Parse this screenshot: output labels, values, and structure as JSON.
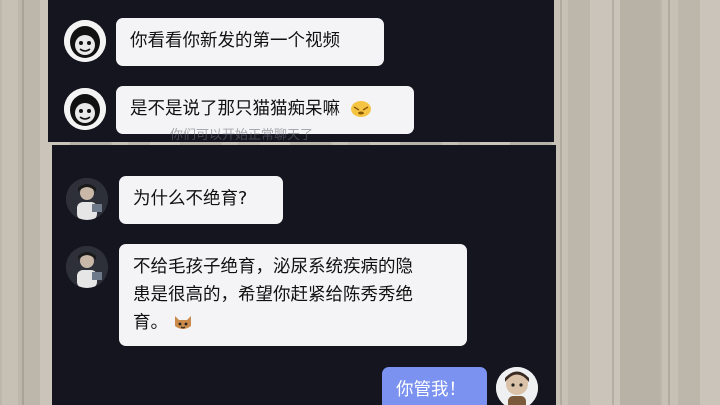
{
  "ghost_text": "你们可以开始正常聊天了",
  "messages": [
    {
      "sender": "meme",
      "text": "你看看你新发的第一个视频"
    },
    {
      "sender": "meme",
      "text": "是不是说了那只猫猫痴呆嘛",
      "emoji": "face-emoji"
    },
    {
      "sender": "photo",
      "text": "为什么不绝育?"
    },
    {
      "sender": "photo",
      "lines": [
        "不给毛孩子绝育，泌尿系统疾病的隐",
        "患是很高的，希望你赶紧给陈秀秀绝",
        "育。"
      ],
      "emoji": "cat-emoji"
    },
    {
      "sender": "me",
      "text": "你管我！"
    }
  ],
  "colors": {
    "panel": "#14151f",
    "bubble": "#f4f4f6",
    "self_bubble": "#7b92f0"
  }
}
